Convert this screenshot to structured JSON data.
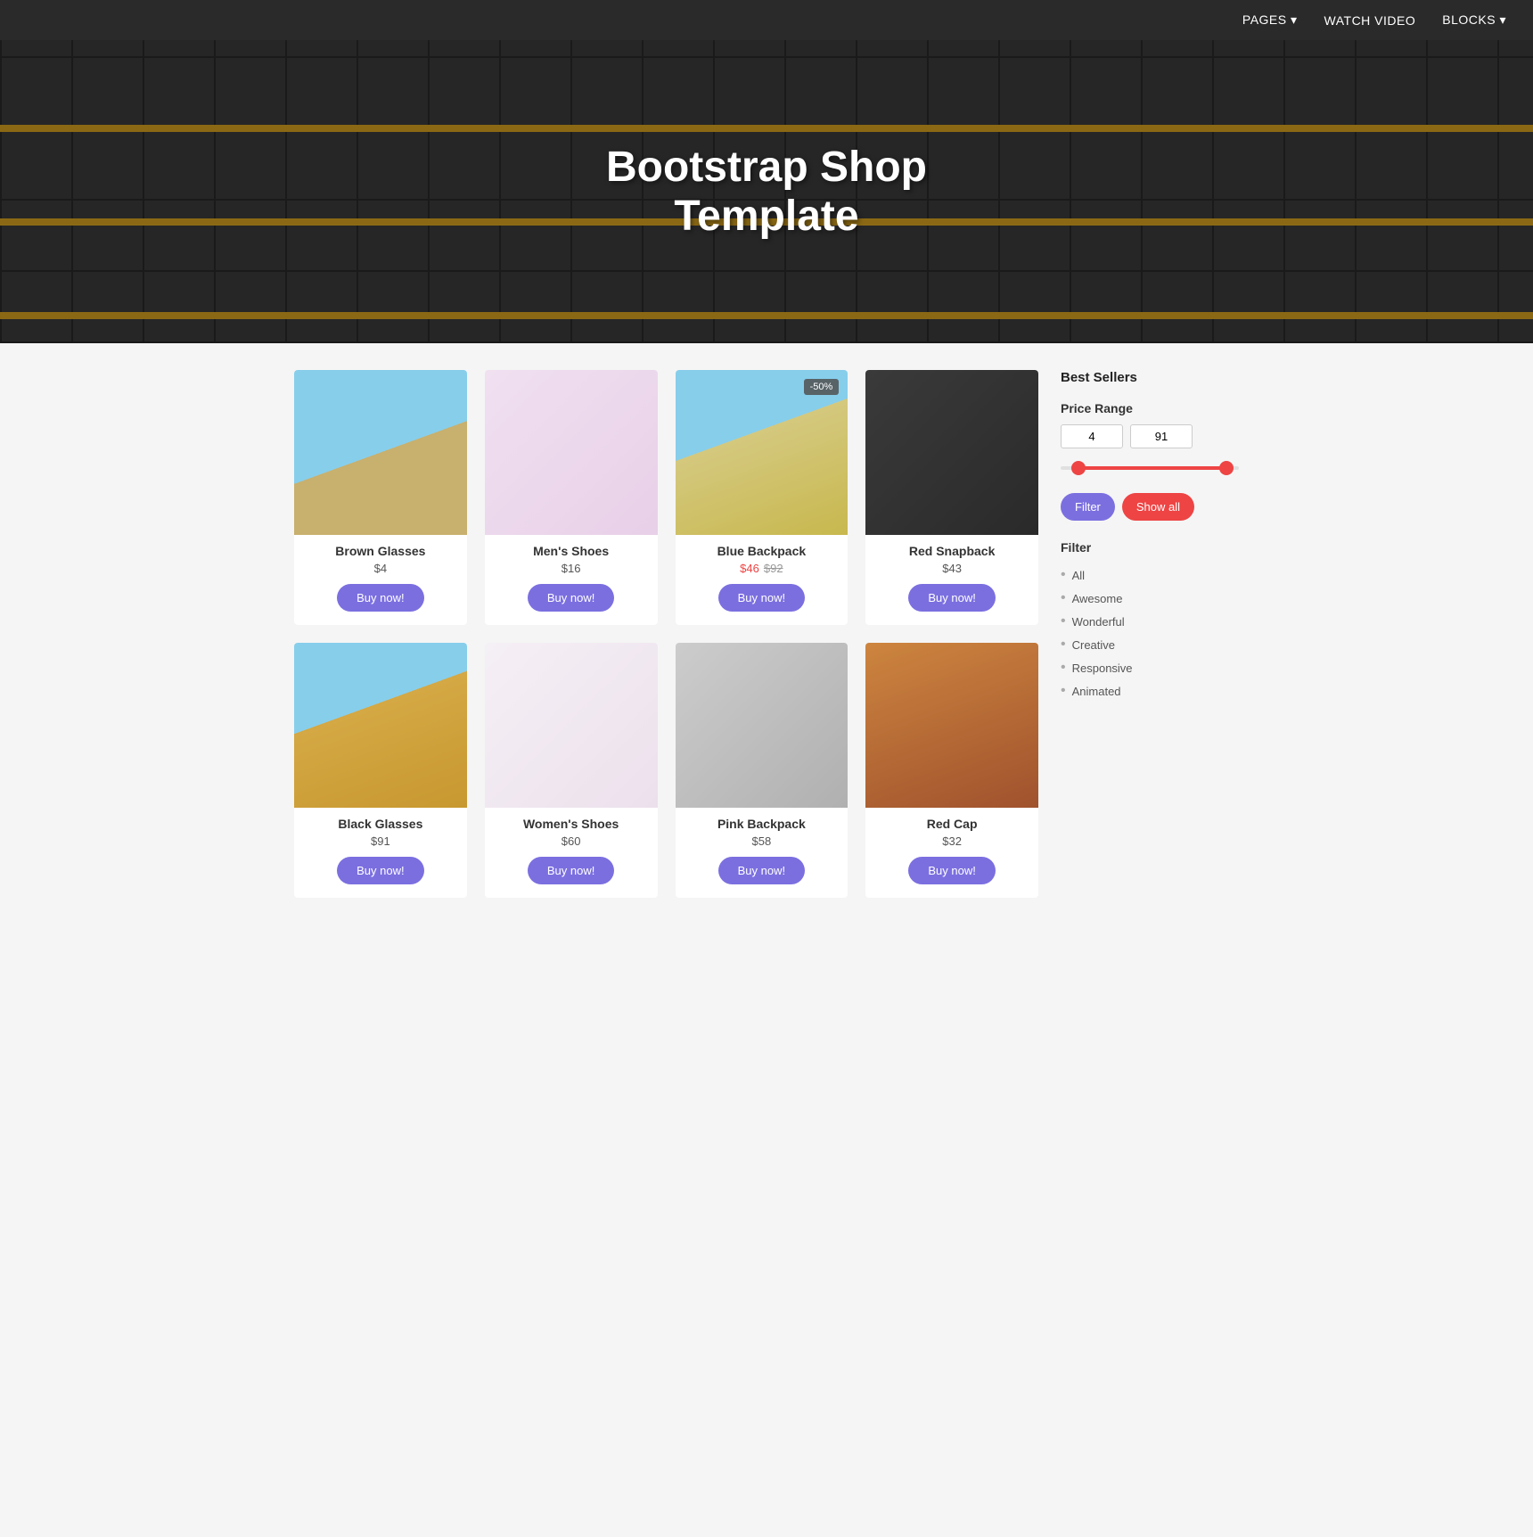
{
  "nav": {
    "items": [
      {
        "label": "PAGES",
        "arrow": "▾",
        "id": "pages"
      },
      {
        "label": "WATCH VIDEO",
        "arrow": "",
        "id": "watch-video"
      },
      {
        "label": "BLOCKS",
        "arrow": "▾",
        "id": "blocks"
      }
    ]
  },
  "hero": {
    "title_line1": "Bootstrap Shop",
    "title_line2": "Template"
  },
  "products": [
    {
      "id": "brown-glasses",
      "name": "Brown Glasses",
      "price": "$4",
      "original_price": null,
      "badge": null,
      "img_class": "img-brown-glasses"
    },
    {
      "id": "mens-shoes",
      "name": "Men's Shoes",
      "price": "$16",
      "original_price": null,
      "badge": null,
      "img_class": "img-mens-shoes"
    },
    {
      "id": "blue-backpack",
      "name": "Blue Backpack",
      "price": "$46",
      "original_price": "$92",
      "badge": "-50%",
      "img_class": "img-blue-backpack"
    },
    {
      "id": "red-snapback",
      "name": "Red Snapback",
      "price": "$43",
      "original_price": null,
      "badge": null,
      "img_class": "img-red-snapback"
    },
    {
      "id": "black-glasses",
      "name": "Black Glasses",
      "price": "$91",
      "original_price": null,
      "badge": null,
      "img_class": "img-black-glasses"
    },
    {
      "id": "womens-shoes",
      "name": "Women's Shoes",
      "price": "$60",
      "original_price": null,
      "badge": null,
      "img_class": "img-womens-shoes"
    },
    {
      "id": "pink-backpack",
      "name": "Pink Backpack",
      "price": "$58",
      "original_price": null,
      "badge": null,
      "img_class": "img-pink-backpack"
    },
    {
      "id": "red-cap",
      "name": "Red Cap",
      "price": "$32",
      "original_price": null,
      "badge": null,
      "img_class": "img-red-cap"
    }
  ],
  "buy_button_label": "Buy now!",
  "sidebar": {
    "best_sellers_label": "Best Sellers",
    "price_range_label": "Price Range",
    "price_min": "4",
    "price_max": "91",
    "filter_button_label": "Filter",
    "show_all_button_label": "Show all",
    "filter_section_label": "Filter",
    "filter_items": [
      {
        "label": "All",
        "id": "filter-all"
      },
      {
        "label": "Awesome",
        "id": "filter-awesome"
      },
      {
        "label": "Wonderful",
        "id": "filter-wonderful"
      },
      {
        "label": "Creative",
        "id": "filter-creative"
      },
      {
        "label": "Responsive",
        "id": "filter-responsive"
      },
      {
        "label": "Animated",
        "id": "filter-animated"
      }
    ]
  }
}
